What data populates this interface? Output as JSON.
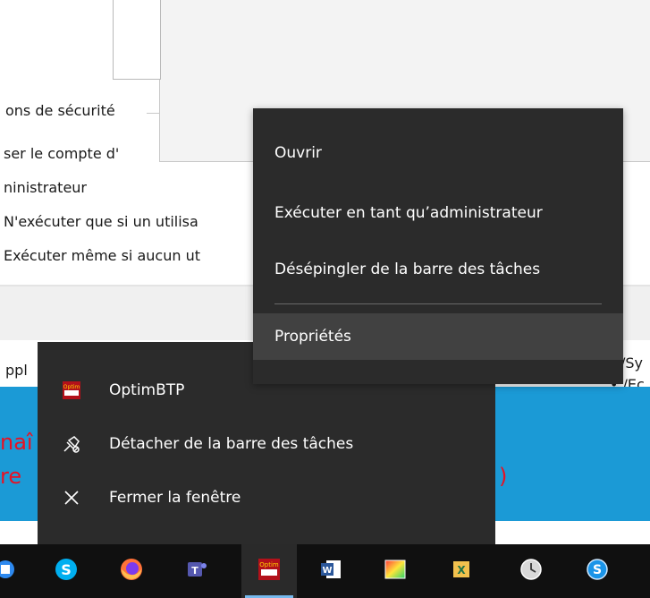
{
  "dialog": {
    "line_security": "ons de sécurité",
    "line_account": "ser le compte d'",
    "line_admin": "ninistrateur",
    "line_option1": "N'exécuter que si un utilisa",
    "line_option2": "Exécuter même si aucun ut",
    "line_appl": "ppl",
    "right_line1": "/Sy",
    "right_line2": "• /Ec"
  },
  "red_text": {
    "line1": "naî",
    "line2": "re",
    "paren": ")"
  },
  "context_menu": {
    "items": [
      {
        "label": "Ouvrir"
      },
      {
        "label": "Exécuter en tant qu’administrateur"
      },
      {
        "label": "Désépingler de la barre des tâches"
      },
      {
        "label": "Propriétés"
      }
    ]
  },
  "jump_list": {
    "items": [
      {
        "label": "OptimBTP",
        "icon": "optimbtp-app-icon"
      },
      {
        "label": "Détacher de la barre des tâches",
        "icon": "unpin-icon"
      },
      {
        "label": "Fermer la fenêtre",
        "icon": "close-icon"
      }
    ]
  },
  "taskbar": {
    "buttons": [
      {
        "name": "taskview-icon"
      },
      {
        "name": "skype-icon"
      },
      {
        "name": "firefox-icon"
      },
      {
        "name": "teams-icon"
      },
      {
        "name": "optimbtp-icon",
        "active": true
      },
      {
        "name": "word-icon"
      },
      {
        "name": "image-viewer-icon"
      },
      {
        "name": "excel-tool-icon"
      },
      {
        "name": "clock-app-icon"
      },
      {
        "name": "skype-business-icon"
      }
    ]
  },
  "colors": {
    "menu_bg": "#2b2b2b",
    "menu_hover": "#414141",
    "taskbar_bg": "#101010",
    "accent": "#1b9ad6",
    "red": "#e81123"
  }
}
